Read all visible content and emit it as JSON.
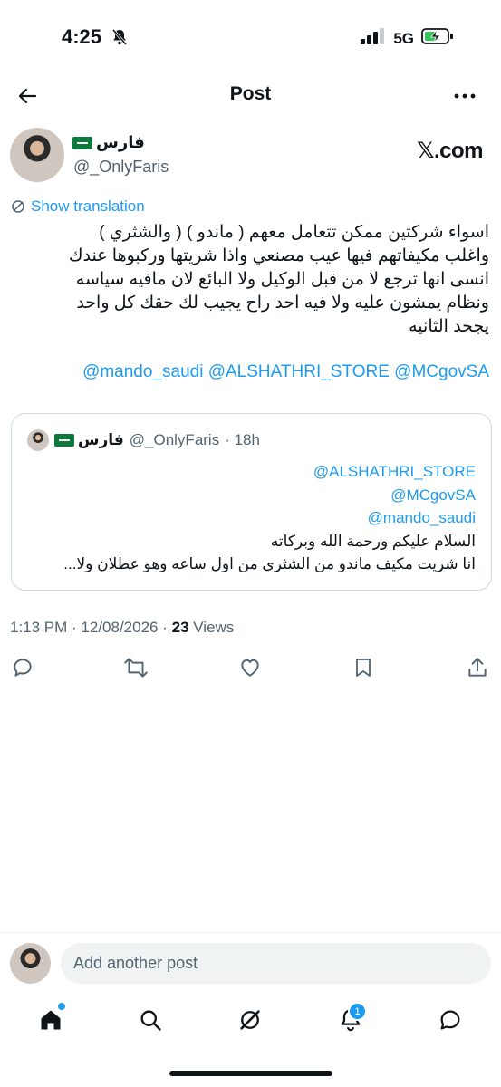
{
  "status_bar": {
    "time": "4:25",
    "network": "5G",
    "icons": [
      "silent-bell-icon",
      "signal-icon",
      "battery-charging-icon"
    ]
  },
  "header": {
    "title": "Post",
    "icons": [
      "back-arrow-icon",
      "more-icon"
    ]
  },
  "author": {
    "name": "فارس",
    "handle": "@_OnlyFaris",
    "flag_icon": "saudi-flag-icon"
  },
  "source_tag": "𝕏.com",
  "translate_label": "Show translation",
  "post": {
    "body": "اسواء شركتين ممكن تتعامل معهم  ( ماندو ) ( والشثري )\nواغلب مكيفاتهم فيها عيب مصنعي واذا شريتها وركبوها عندك\nانسى انها ترجع لا من قبل الوكيل ولا البائع لان مافيه سياسه\nونظام يمشون عليه ولا فيه احد راح يجيب لك حقك كل واحد\nيجحد الثانيه",
    "mentions": "@mando_saudi @ALSHATHRI_STORE @MCgovSA"
  },
  "quote": {
    "name": "فارس",
    "handle": "@_OnlyFaris",
    "time": "· 18h",
    "links": [
      "@ALSHATHRI_STORE",
      "@MCgovSA",
      "@mando_saudi"
    ],
    "text_line1": "السلام عليكم ورحمة الله وبركاته",
    "text_line2": "انا شريت مكيف ماندو من الشثري من اول ساعه وهو عطلان ولا..."
  },
  "meta": {
    "timestamp": "1:13 PM · 12/08/2026 · ",
    "views_count": "23",
    "views_label": " Views"
  },
  "actions": [
    "reply-icon",
    "repost-icon",
    "like-icon",
    "bookmark-icon",
    "share-icon"
  ],
  "composer": {
    "placeholder": "Add another post"
  },
  "bottom_nav": {
    "items": [
      "home-icon",
      "search-icon",
      "grok-icon",
      "notifications-icon",
      "messages-icon"
    ],
    "notifications_badge": "1"
  },
  "colors": {
    "accent": "#1d9bf0",
    "text": "#0f1419",
    "secondary": "#536471",
    "border": "#cfd9de"
  }
}
